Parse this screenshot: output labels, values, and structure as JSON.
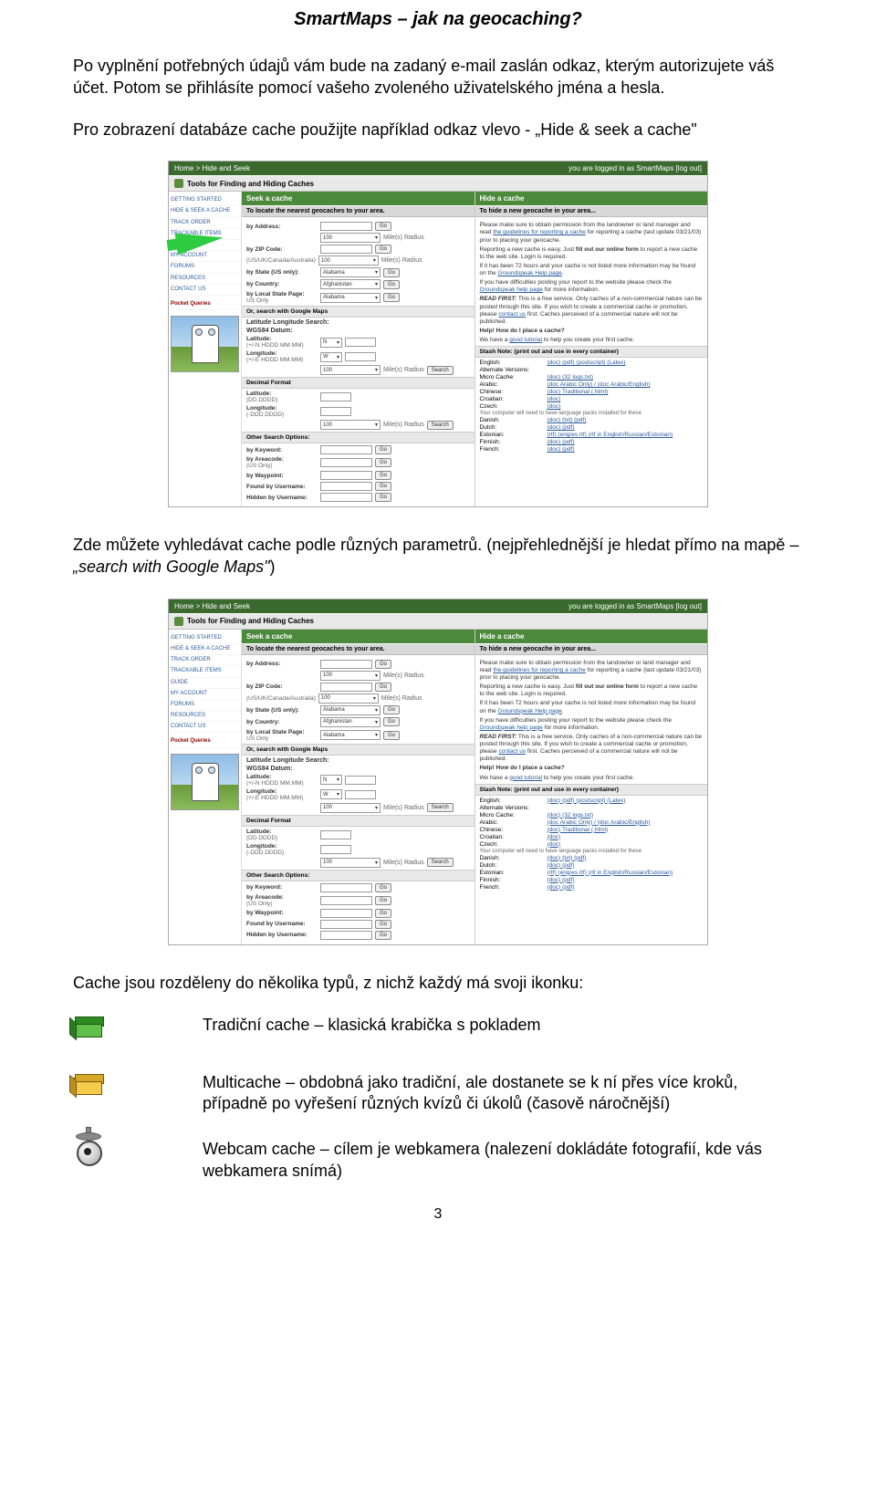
{
  "title": "SmartMaps – jak na geocaching?",
  "p1": "Po vyplnění potřebných údajů vám bude na zadaný e-mail zaslán odkaz, kterým autorizujete váš účet. Potom se přihlásíte pomocí vašeho zvoleného uživatelského jména a hesla.",
  "p2": "Pro zobrazení databáze cache použijte například odkaz vlevo - „Hide & seek a cache\"",
  "p3_a": "Zde můžete vyhledávat cache podle různých parametrů. (nejpřehlednější je hledat přímo na mapě – ",
  "p3_i": "„search with Google Maps\"",
  "p3_b": ")",
  "p4": "Cache jsou rozděleny do několika typů, z nichž každý má svoji ikonku:",
  "cache_types": {
    "traditional": "Tradiční cache – klasická krabička s pokladem",
    "multi": "Multicache – obdobná jako tradiční, ale dostanete se k ní přes více kroků, případně po vyřešení různých kvízů či úkolů (časově náročnější)",
    "webcam": "Webcam cache – cílem je webkamera (nalezení dokládáte fotografií, kde vás webkamera snímá)"
  },
  "page_number": "3",
  "ss": {
    "breadcrumb": "Home > Hide and Seek",
    "login": "you are logged in as SmartMaps [log out]",
    "toolbar": "Tools for Finding and Hiding Caches",
    "side_links": [
      "GETTING STARTED",
      "HIDE & SEEK A CACHE",
      "TRACK ORDER",
      "TRACKABLE ITEMS",
      "GUIDE",
      "MY ACCOUNT",
      "FORUMS",
      "RESOURCES",
      "CONTACT US"
    ],
    "side_promo_t": "Pocket Queries",
    "seek_head": "Seek a cache",
    "seek_sub": "To locate the nearest geocaches to your area.",
    "hide_head": "Hide a cache",
    "hide_sub": "To hide a new geocache in your area...",
    "rows": {
      "addr": "by Address:",
      "zip": "by ZIP Code:",
      "zip_hint": "(US/UK/Canada/Australia)",
      "state": "by State (US only):",
      "country": "by Country:",
      "local": "by Local State Page:",
      "local_hint": "US Only",
      "google": "Or, search with Google Maps",
      "llhead": "Latitude Longitude Search:",
      "datum": "WGS84 Datum:",
      "lat": "Latitude:",
      "lat_hint": "(+/-N HDDD MM.MM)",
      "lon": "Longitude:",
      "lon_hint": "(+/-E HDDD MM.MM)",
      "dec": "Decimal Format",
      "dlat": "Latitude:",
      "dlat_h": "(DD.DDDD)",
      "dlon": "Longitude:",
      "dlon_h": "(-DDD.DDDD)",
      "other": "Other Search Options:",
      "kw": "by Keyword:",
      "ac": "by Areacode:",
      "ac_h": "(US Only)",
      "wp": "by Waypoint:",
      "fu": "Found by Username:",
      "hu": "Hidden by Username:",
      "go": "Go",
      "search": "Search",
      "radius": "Mile(s) Radius",
      "radius_v": "100",
      "n": "N",
      "w": "W",
      "alabama": "Alabama",
      "afghan": "Afghanistan"
    },
    "right": {
      "perm": "Please make sure to obtain permission from the landowner or land manager and read the guidelines for reporting a cache (last update 03/21/03) prior to placing your geocache.",
      "report": "Reporting a new cache is easy. Just fill out our online form to report a new cache to the web site. Login is required.",
      "hours": "If it has been 72 hours and your cache is not listed more information may be found on the Groundspeak Help page.",
      "diff": "If you have difficulties posting your report to the website please check the Groundspeak help page for more information.",
      "readfirst": "READ FIRST: This is a free service. Only caches of a non-commercial nature can be posted through this site. If you wish to create a commercial cache or promotion, please contact us first. Caches perceived of a commercial nature will not be published.",
      "help": "Help! How do I place a cache?",
      "tutorial": "We have a good tutorial to help you create your first cache.",
      "stash": "Stash Note: (print out and use in every container)",
      "langs": [
        {
          "n": "English:",
          "l": "(doc) (pdf) (postscript) (Latex)"
        },
        {
          "n": "Alternate Versions:",
          "l": ""
        },
        {
          "n": "Micro Cache:",
          "l": "(doc) (32 logs.txt)"
        },
        {
          "n": "Arabic:",
          "l": "(doc Arabic Only) / (doc Arabic/English)"
        },
        {
          "n": "Chinese:",
          "l": "(doc) Traditional (.html)"
        },
        {
          "n": "Croatian:",
          "l": "(doc)"
        },
        {
          "n": "Czech:",
          "l": "(doc)"
        },
        {
          "n": "",
          "l": "Your computer will need to have language packs installed for these"
        },
        {
          "n": "Danish:",
          "l": "(doc) (txt) (pdf)"
        },
        {
          "n": "Dutch:",
          "l": "(doc) (pdf)"
        },
        {
          "n": "Estonian:",
          "l": "(rtf) (eng/es rtf) (rtf in English/Russian/Estonian)"
        },
        {
          "n": "Finnish:",
          "l": "(doc) (pdf)"
        },
        {
          "n": "French:",
          "l": "(doc) (pdf)"
        }
      ]
    }
  }
}
